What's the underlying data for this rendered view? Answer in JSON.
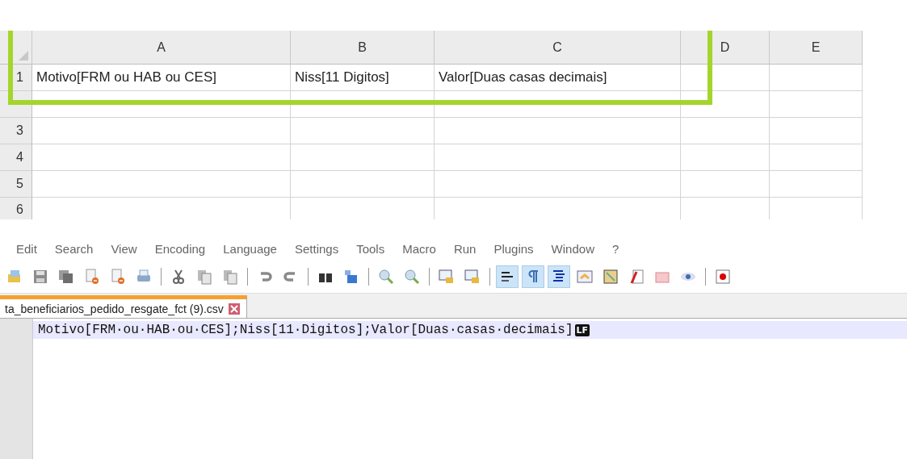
{
  "spreadsheet": {
    "columns": [
      "A",
      "B",
      "C",
      "D",
      "E"
    ],
    "rows": [
      {
        "label": "1",
        "cells": [
          "Motivo[FRM ou HAB ou CES]",
          "Niss[11 Digitos]",
          "Valor[Duas casas decimais]"
        ]
      },
      {
        "cells": []
      },
      {
        "label": "3",
        "cells": []
      },
      {
        "label": "4",
        "cells": []
      },
      {
        "label": "5",
        "cells": []
      },
      {
        "label": "6",
        "cells": []
      }
    ]
  },
  "editor": {
    "menu": [
      "Edit",
      "Search",
      "View",
      "Encoding",
      "Language",
      "Settings",
      "Tools",
      "Macro",
      "Run",
      "Plugins",
      "Window",
      "?"
    ],
    "toolbar": [
      [
        {
          "pressed": false
        },
        {
          "pressed": false
        },
        {
          "pressed": false
        },
        {
          "pressed": false
        },
        {
          "pressed": false
        },
        {
          "pressed": false
        }
      ],
      [
        {
          "pressed": false
        },
        {
          "pressed": false
        },
        {
          "pressed": false
        }
      ],
      [
        {
          "pressed": false
        },
        {
          "pressed": false
        }
      ],
      [
        {
          "pressed": false
        },
        {
          "pressed": false
        }
      ],
      [
        {
          "pressed": false
        },
        {
          "pressed": false
        }
      ],
      [
        {
          "pressed": false
        },
        {
          "pressed": false
        }
      ],
      [
        {
          "pressed": true
        },
        {
          "pressed": true
        },
        {
          "pressed": true
        },
        {
          "pressed": false
        },
        {
          "pressed": false
        },
        {
          "pressed": false
        },
        {
          "pressed": false
        },
        {
          "pressed": false
        }
      ],
      [
        {
          "pressed": false
        }
      ]
    ],
    "tabs": [
      {
        "label": "ta_beneficiarios_pedido_resgate_fct (9).csv",
        "selected": true
      }
    ],
    "lines": [
      {
        "text": "Motivo[FRM·ou·HAB·ou·CES];Niss[11·Digitos];Valor[Duas·casas·decimais]",
        "eol": "LF",
        "current": true
      }
    ]
  }
}
